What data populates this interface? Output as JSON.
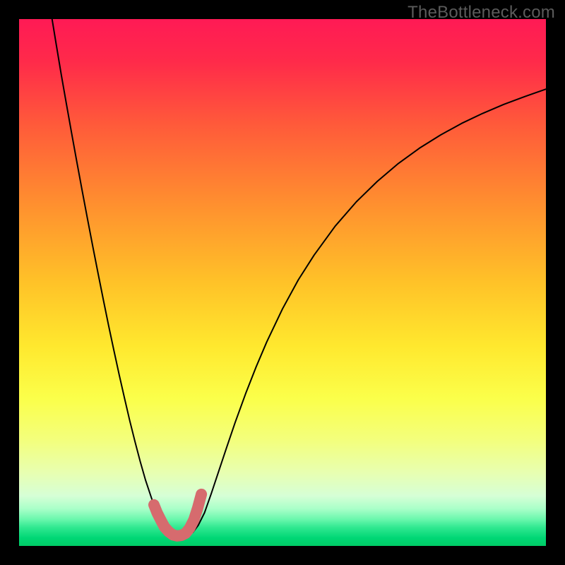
{
  "watermark": "TheBottleneck.com",
  "chart_data": {
    "type": "line",
    "title": "",
    "xlabel": "",
    "ylabel": "",
    "xlim": [
      0,
      1
    ],
    "ylim": [
      0,
      1
    ],
    "background": {
      "type": "vertical-gradient",
      "stops": [
        {
          "offset": 0.0,
          "color": "#ff1a55"
        },
        {
          "offset": 0.08,
          "color": "#ff2a4a"
        },
        {
          "offset": 0.2,
          "color": "#ff5a3a"
        },
        {
          "offset": 0.35,
          "color": "#ff8f2f"
        },
        {
          "offset": 0.5,
          "color": "#ffc228"
        },
        {
          "offset": 0.62,
          "color": "#ffe82e"
        },
        {
          "offset": 0.72,
          "color": "#fbff4a"
        },
        {
          "offset": 0.8,
          "color": "#f3ff7d"
        },
        {
          "offset": 0.86,
          "color": "#e8ffb0"
        },
        {
          "offset": 0.905,
          "color": "#d6ffd6"
        },
        {
          "offset": 0.93,
          "color": "#a8ffc8"
        },
        {
          "offset": 0.95,
          "color": "#68f7ac"
        },
        {
          "offset": 0.965,
          "color": "#30e890"
        },
        {
          "offset": 0.985,
          "color": "#00d775"
        },
        {
          "offset": 1.0,
          "color": "#00cc66"
        }
      ]
    },
    "series": [
      {
        "name": "curve",
        "color": "#000000",
        "width": 2,
        "x": [
          0.061,
          0.07,
          0.08,
          0.09,
          0.1,
          0.11,
          0.12,
          0.13,
          0.14,
          0.15,
          0.16,
          0.17,
          0.18,
          0.19,
          0.2,
          0.21,
          0.22,
          0.23,
          0.24,
          0.25,
          0.255,
          0.26,
          0.267,
          0.275,
          0.283,
          0.292,
          0.3,
          0.31,
          0.32,
          0.33,
          0.34,
          0.352,
          0.365,
          0.38,
          0.395,
          0.41,
          0.43,
          0.45,
          0.47,
          0.5,
          0.53,
          0.56,
          0.6,
          0.64,
          0.68,
          0.72,
          0.76,
          0.8,
          0.84,
          0.88,
          0.92,
          0.96,
          1.0
        ],
        "y": [
          1.01,
          0.955,
          0.895,
          0.838,
          0.782,
          0.727,
          0.673,
          0.62,
          0.568,
          0.517,
          0.467,
          0.418,
          0.371,
          0.325,
          0.281,
          0.238,
          0.198,
          0.16,
          0.125,
          0.095,
          0.08,
          0.066,
          0.05,
          0.036,
          0.026,
          0.02,
          0.019,
          0.019,
          0.02,
          0.026,
          0.039,
          0.063,
          0.1,
          0.145,
          0.19,
          0.234,
          0.289,
          0.34,
          0.387,
          0.45,
          0.505,
          0.552,
          0.607,
          0.653,
          0.692,
          0.726,
          0.755,
          0.78,
          0.802,
          0.821,
          0.838,
          0.853,
          0.867
        ]
      },
      {
        "name": "highlight",
        "color": "#d66b6e",
        "width": 16,
        "linecap": "round",
        "x": [
          0.256,
          0.262,
          0.269,
          0.276,
          0.284,
          0.292,
          0.3,
          0.308,
          0.316,
          0.324,
          0.332,
          0.339,
          0.346
        ],
        "y": [
          0.078,
          0.063,
          0.049,
          0.036,
          0.027,
          0.021,
          0.019,
          0.02,
          0.024,
          0.034,
          0.05,
          0.072,
          0.098
        ]
      }
    ]
  }
}
